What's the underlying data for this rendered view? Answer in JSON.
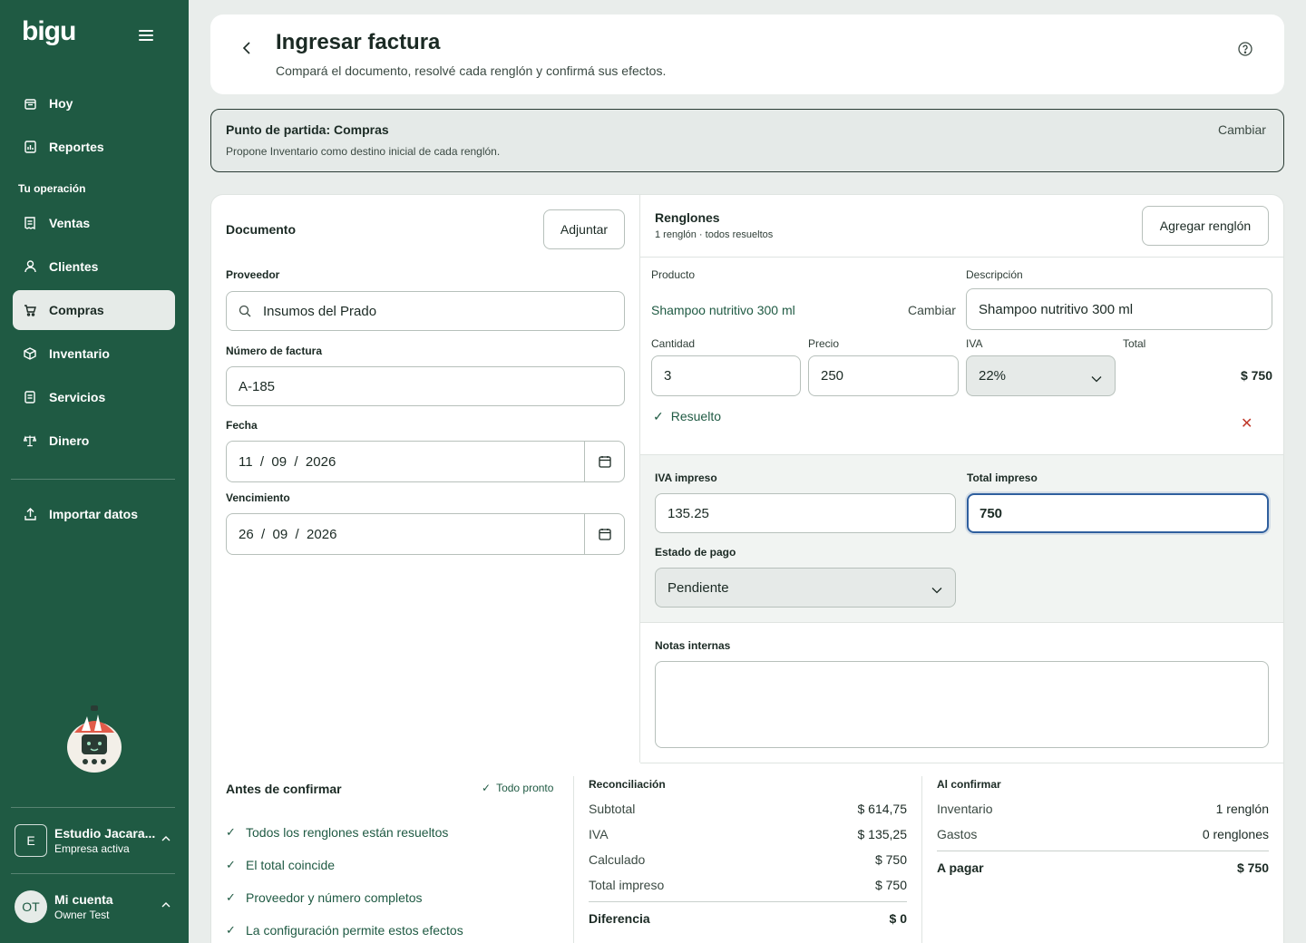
{
  "sidebar": {
    "logo": "bigu",
    "items": [
      {
        "label": "Hoy"
      },
      {
        "label": "Reportes"
      },
      {
        "label": "Ventas"
      },
      {
        "label": "Clientes"
      },
      {
        "label": "Compras"
      },
      {
        "label": "Inventario"
      },
      {
        "label": "Servicios"
      },
      {
        "label": "Dinero"
      },
      {
        "label": "Importar datos"
      }
    ],
    "section_label": "Tu operación",
    "company": {
      "badge": "E",
      "name": "Estudio Jacara...",
      "sub": "Empresa activa"
    },
    "account": {
      "badge": "OT",
      "name": "Mi cuenta",
      "sub": "Owner Test"
    }
  },
  "header": {
    "title": "Ingresar factura",
    "subtitle": "Compará el documento, resolvé cada renglón y confirmá sus efectos."
  },
  "start": {
    "title": "Punto de partida: Compras",
    "subtitle": "Propone Inventario como destino inicial de cada renglón.",
    "change": "Cambiar"
  },
  "document": {
    "title": "Documento",
    "attach": "Adjuntar",
    "supplier_label": "Proveedor",
    "supplier_value": "Insumos del Prado",
    "invoice_label": "Número de factura",
    "invoice_value": "A-185",
    "date_label": "Fecha",
    "date_value": "11  /  09  /  2026",
    "due_label": "Vencimiento",
    "due_value": "26  /  09  /  2026"
  },
  "lines": {
    "title": "Renglones",
    "subtitle": "1 renglón · todos resueltos",
    "add": "Agregar renglón",
    "product_label": "Producto",
    "product_value": "Shampoo nutritivo 300 ml",
    "product_change": "Cambiar",
    "desc_label": "Descripción",
    "desc_value": "Shampoo nutritivo 300 ml",
    "qty_label": "Cantidad",
    "qty_value": "3",
    "price_label": "Precio",
    "price_value": "250",
    "iva_label": "IVA",
    "iva_value": "22%",
    "total_label": "Total",
    "total_value": "$ 750",
    "resolved": "Resuelto"
  },
  "printed": {
    "iva_label": "IVA impreso",
    "iva_value": "135.25",
    "total_label": "Total impreso",
    "total_value": "750",
    "payment_label": "Estado de pago",
    "payment_value": "Pendiente"
  },
  "notes": {
    "label": "Notas internas",
    "value": ""
  },
  "checks": {
    "title": "Antes de confirmar",
    "status": "Todo pronto",
    "items": [
      "Todos los renglones están resueltos",
      "El total coincide",
      "Proveedor y número completos",
      "La configuración permite estos efectos"
    ]
  },
  "reconciliation": {
    "title": "Reconciliación",
    "rows": [
      {
        "k": "Subtotal",
        "v": "$ 614,75"
      },
      {
        "k": "IVA",
        "v": "$ 135,25"
      },
      {
        "k": "Calculado",
        "v": "$ 750"
      },
      {
        "k": "Total impreso",
        "v": "$ 750"
      }
    ],
    "diff_label": "Diferencia",
    "diff_value": "$ 0"
  },
  "on_confirm": {
    "title": "Al confirmar",
    "rows": [
      {
        "k": "Inventario",
        "v": "1 renglón"
      },
      {
        "k": "Gastos",
        "v": "0 renglones"
      }
    ],
    "pay_label": "A pagar",
    "pay_value": "$ 750"
  },
  "colors": {
    "sidebar": "#1f5a43",
    "accent_green": "#1f5a43",
    "focus_blue": "#2f5f9e",
    "danger": "#c0392b"
  }
}
